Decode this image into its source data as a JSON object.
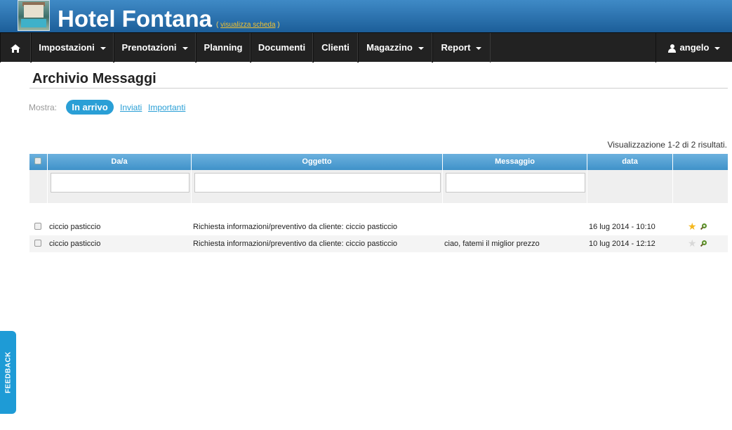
{
  "header": {
    "title": "Hotel Fontana",
    "view_link_open": "(",
    "view_link": "visualizza scheda",
    "view_link_close": ")"
  },
  "navbar": {
    "items": [
      {
        "label": "Impostazioni",
        "dropdown": true
      },
      {
        "label": "Prenotazioni",
        "dropdown": true
      },
      {
        "label": "Planning",
        "dropdown": false
      },
      {
        "label": "Documenti",
        "dropdown": false
      },
      {
        "label": "Clienti",
        "dropdown": false
      },
      {
        "label": "Magazzino",
        "dropdown": true
      },
      {
        "label": "Report",
        "dropdown": true
      }
    ],
    "user": "angelo"
  },
  "page": {
    "title": "Archivio Messaggi",
    "filter_label": "Mostra:",
    "filters": [
      "In arrivo",
      "Inviati",
      "Importanti"
    ],
    "active_filter": "In arrivo",
    "summary": "Visualizzazione 1-2 di 2 risultati."
  },
  "table": {
    "columns": [
      "Da/a",
      "Oggetto",
      "Messaggio",
      "data"
    ],
    "rows": [
      {
        "from": "ciccio pasticcio",
        "subject": "Richiesta informazioni/preventivo da cliente: ciccio pasticcio",
        "message": "",
        "date": "16 lug 2014 - 10:10",
        "starred": true
      },
      {
        "from": "ciccio pasticcio",
        "subject": "Richiesta informazioni/preventivo da cliente: ciccio pasticcio",
        "message": "ciao, fatemi il miglior prezzo",
        "date": "10 lug 2014 - 12:12",
        "starred": false
      }
    ]
  },
  "feedback": "FEEDBACK",
  "colors": {
    "accent": "#2a9fd6",
    "navbar": "#222222",
    "header": "#2a6fad",
    "star": "#f5b71c"
  }
}
